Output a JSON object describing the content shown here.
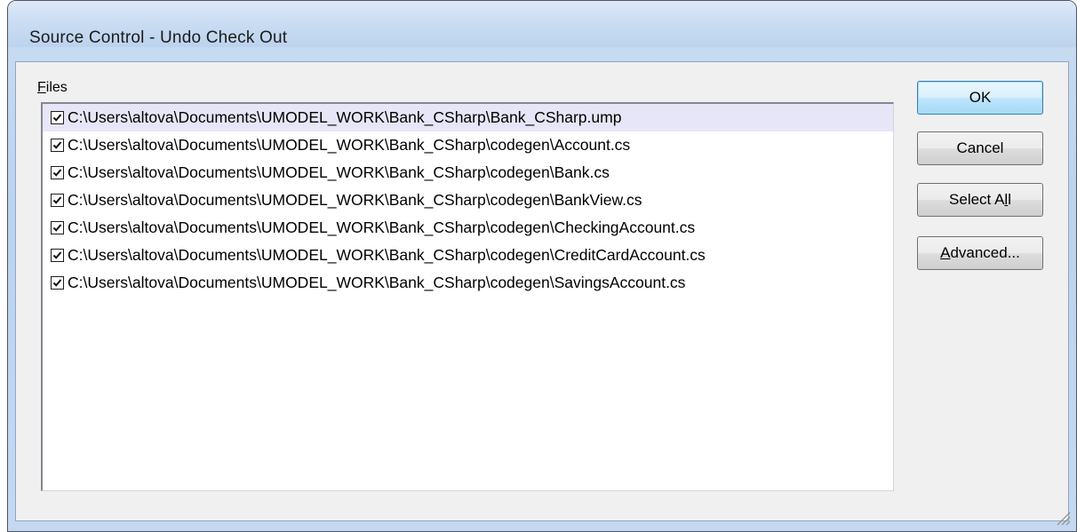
{
  "window": {
    "title": "Source Control - Undo Check Out"
  },
  "files": {
    "label_accel": "F",
    "label_rest": "iles",
    "items": [
      {
        "checked": true,
        "path": "C:\\Users\\altova\\Documents\\UMODEL_WORK\\Bank_CSharp\\Bank_CSharp.ump",
        "selected": true
      },
      {
        "checked": true,
        "path": "C:\\Users\\altova\\Documents\\UMODEL_WORK\\Bank_CSharp\\codegen\\Account.cs"
      },
      {
        "checked": true,
        "path": "C:\\Users\\altova\\Documents\\UMODEL_WORK\\Bank_CSharp\\codegen\\Bank.cs"
      },
      {
        "checked": true,
        "path": "C:\\Users\\altova\\Documents\\UMODEL_WORK\\Bank_CSharp\\codegen\\BankView.cs"
      },
      {
        "checked": true,
        "path": "C:\\Users\\altova\\Documents\\UMODEL_WORK\\Bank_CSharp\\codegen\\CheckingAccount.cs"
      },
      {
        "checked": true,
        "path": "C:\\Users\\altova\\Documents\\UMODEL_WORK\\Bank_CSharp\\codegen\\CreditCardAccount.cs"
      },
      {
        "checked": true,
        "path": "C:\\Users\\altova\\Documents\\UMODEL_WORK\\Bank_CSharp\\codegen\\SavingsAccount.cs"
      }
    ]
  },
  "buttons": {
    "ok": "OK",
    "cancel": "Cancel",
    "select_all_pre": "Select A",
    "select_all_accel": "l",
    "select_all_post": "l",
    "advanced_accel": "A",
    "advanced_rest": "dvanced..."
  },
  "colors": {
    "selected_row": "#e6e6f8",
    "default_button_border": "#3c7fb1"
  },
  "icons": {
    "checkbox": "checkmark-icon",
    "resize": "resize-grip-icon"
  }
}
